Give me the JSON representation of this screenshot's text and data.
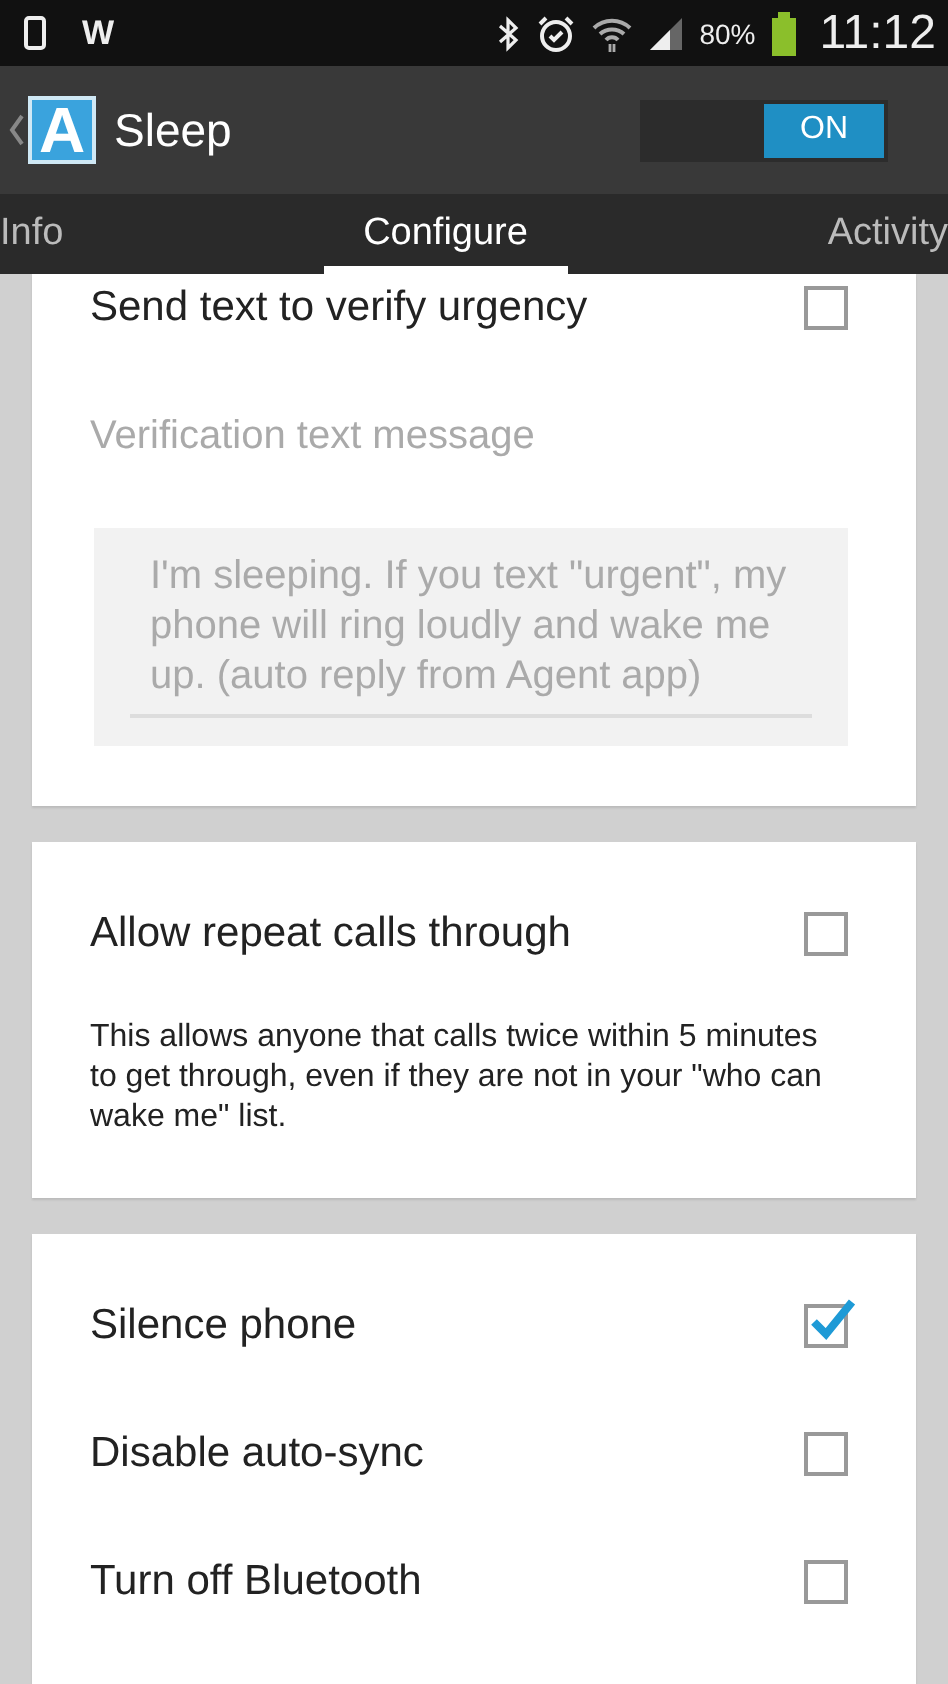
{
  "status_bar": {
    "notification": "W",
    "battery_percent": "80%",
    "time": "11:12"
  },
  "action_bar": {
    "app_icon_letter": "A",
    "title": "Sleep",
    "toggle": {
      "label": "ON",
      "on": true
    }
  },
  "tabs": [
    {
      "label": "Info",
      "selected": false
    },
    {
      "label": "Configure",
      "selected": true
    },
    {
      "label": "Activity",
      "selected": false
    }
  ],
  "cards": [
    {
      "rows": [
        {
          "kind": "checkbox",
          "label": "Send text to verify urgency",
          "checked": false
        },
        {
          "kind": "field_label",
          "label": "Verification text message",
          "disabled": true
        },
        {
          "kind": "textarea",
          "value": "I'm sleeping. If you text \"urgent\", my phone will ring loudly and wake me up. (auto reply from Agent app)",
          "disabled": true
        }
      ]
    },
    {
      "rows": [
        {
          "kind": "checkbox",
          "label": "Allow repeat calls through",
          "checked": false
        },
        {
          "kind": "description",
          "text": "This allows anyone that calls twice within 5 minutes to get through, even if they are not in your \"who can wake me\" list."
        }
      ]
    },
    {
      "rows": [
        {
          "kind": "checkbox",
          "label": "Silence phone",
          "checked": true
        },
        {
          "kind": "checkbox",
          "label": "Disable auto-sync",
          "checked": false
        },
        {
          "kind": "checkbox",
          "label": "Turn off Bluetooth",
          "checked": false
        }
      ]
    }
  ]
}
